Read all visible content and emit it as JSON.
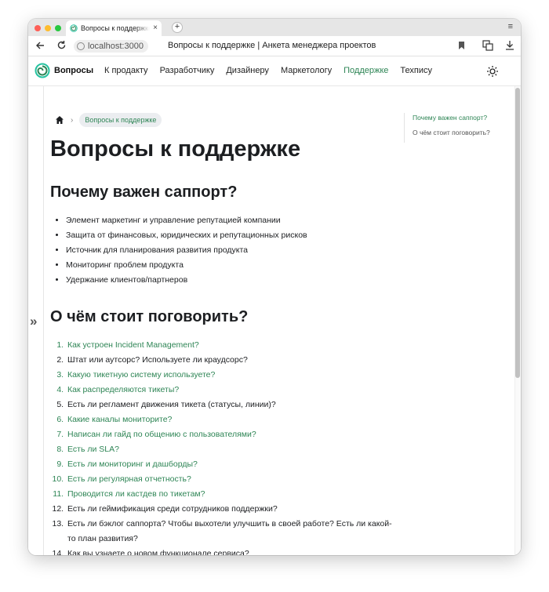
{
  "browser": {
    "tab_title": "Вопросы к поддержке",
    "tab_close": "×",
    "new_tab": "+",
    "tab_menu": "≡",
    "address": "localhost:3000",
    "page_title": "Вопросы к поддержке | Анкета менеджера проектов",
    "icons": [
      "back-icon",
      "reload-icon",
      "site-info-icon",
      "bookmark-icon",
      "translate-icon",
      "download-icon"
    ]
  },
  "navbar": {
    "logo_text": "Вопросы",
    "links": [
      {
        "label": "К продакту",
        "active": false
      },
      {
        "label": "Разработчику",
        "active": false
      },
      {
        "label": "Дизайнеру",
        "active": false
      },
      {
        "label": "Маркетологу",
        "active": false
      },
      {
        "label": "Поддержке",
        "active": true
      },
      {
        "label": "Техпису",
        "active": false
      }
    ],
    "accent_color": "#2e8555"
  },
  "breadcrumb": {
    "current": "Вопросы к поддержке"
  },
  "sidebar_toggle": "»",
  "article": {
    "title": "Вопросы к поддержке",
    "section1": {
      "heading": "Почему важен саппорт?",
      "items": [
        "Элемент маркетинг и управление репутацией компании",
        "Защита от финансовых, юридических и репутационных рисков",
        "Источник для планирования развития продукта",
        "Мониторинг проблем продукта",
        "Удержание клиентов/партнеров"
      ]
    },
    "section2": {
      "heading": "О чём стоит поговорить?",
      "items": [
        {
          "text": "Как устроен Incident Management?",
          "link": true
        },
        {
          "text": "Штат или аутсорс? Используете ли краудсорс?",
          "link": false
        },
        {
          "text": "Какую тикетную систему используете?",
          "link": true
        },
        {
          "text": "Как распределяются тикеты?",
          "link": true
        },
        {
          "text": "Есть ли регламент движения тикета (статусы, линии)?",
          "link": false
        },
        {
          "text": "Какие каналы мониторите?",
          "link": true
        },
        {
          "text": "Написан ли гайд по общению с пользователями?",
          "link": true
        },
        {
          "text": "Есть ли SLA?",
          "link": true
        },
        {
          "text": "Есть ли мониторинг и дашборды?",
          "link": true
        },
        {
          "text": "Есть ли регулярная отчетность?",
          "link": true
        },
        {
          "text": "Проводится ли кастдев по тикетам?",
          "link": true
        },
        {
          "text": "Есть ли геймификация среди сотрудников поддержки?",
          "link": false
        },
        {
          "text": "Есть ли бэклог саппорта? Чтобы выхотели улучшить в своей работе? Есть ли какой-то план развития?",
          "link": false
        },
        {
          "text": "Как вы узнаете о новом функционале сервиса?",
          "link": false
        }
      ]
    }
  },
  "toc": {
    "items": [
      {
        "label": "Почему важен саппорт?",
        "active": true
      },
      {
        "label": "О чём стоит поговорить?",
        "active": false
      }
    ]
  }
}
